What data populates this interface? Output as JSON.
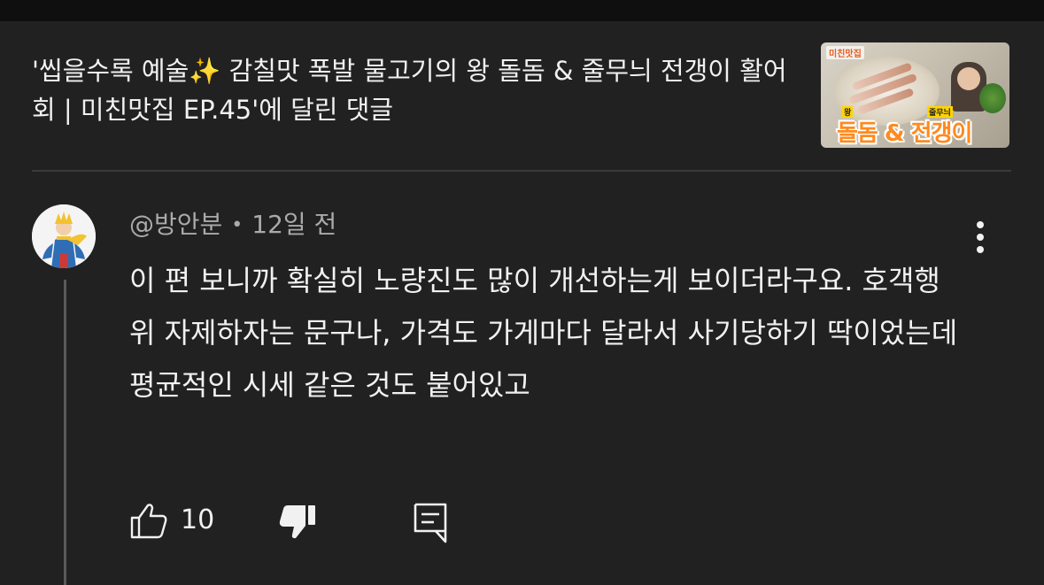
{
  "video": {
    "title": "'씹을수록 예술✨ 감칠맛 폭발 물고기의 왕 돌돔 & 줄무늬 전갱이 활어회 | 미친맛집 EP.45'에 달린 댓글",
    "thumbnail": {
      "tag": "미친맛집",
      "caption_small_left": "왕",
      "caption_small_right": "줄무늬",
      "caption": "돌돔 & 전갱이"
    }
  },
  "comment": {
    "author": "@방안분",
    "separator": "•",
    "time": "12일 전",
    "text": "이 편 보니까 확실히 노량진도 많이 개선하는게 보이더라구요. 호객행위 자제하자는 문구나, 가격도 가게마다 달라서 사기당하기 딱이었는데 평균적인 시세 같은 것도 붙어있고",
    "likes": "10"
  },
  "colors": {
    "background": "#212121",
    "text": "#f1f1f1",
    "secondary_text": "#aaaaaa",
    "thumbnail_caption": "#ff8a1f"
  },
  "icons": {
    "like": "thumbs-up-icon",
    "dislike": "thumbs-down-icon",
    "reply": "reply-icon",
    "more": "more-vert-icon"
  }
}
